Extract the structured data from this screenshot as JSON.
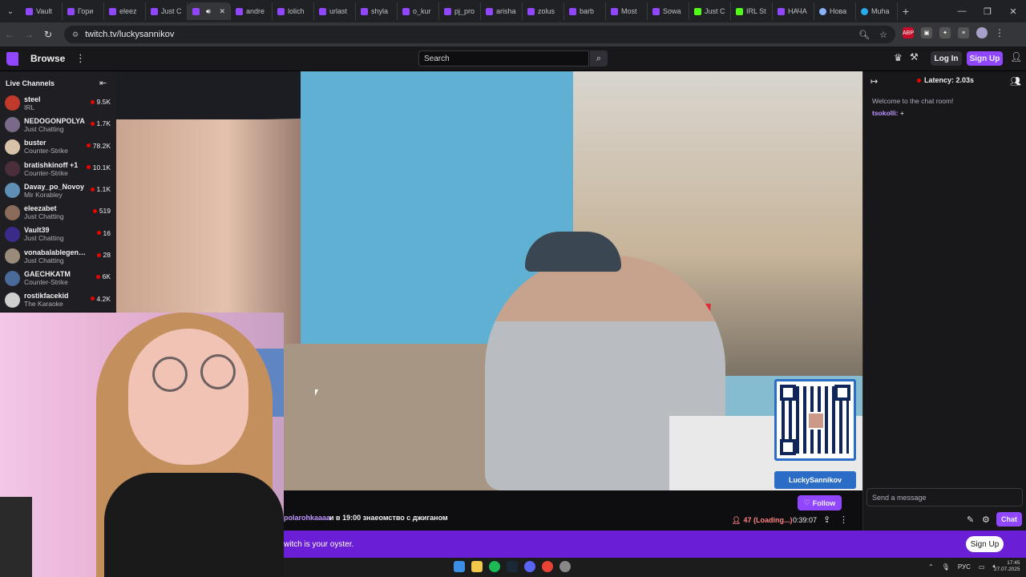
{
  "browser": {
    "tabs": [
      {
        "title": "Vault",
        "icon": "twitch-icon"
      },
      {
        "title": "Гори",
        "icon": "twitch-icon"
      },
      {
        "title": "eleez",
        "icon": "twitch-icon"
      },
      {
        "title": "Just C",
        "icon": "twitch-icon"
      },
      {
        "title": "",
        "icon": "twitch-icon",
        "active": true
      },
      {
        "title": "andre",
        "icon": "twitch-icon"
      },
      {
        "title": "lolich",
        "icon": "twitch-icon"
      },
      {
        "title": "urlast",
        "icon": "twitch-icon"
      },
      {
        "title": "shyla",
        "icon": "twitch-icon"
      },
      {
        "title": "o_kur",
        "icon": "twitch-icon"
      },
      {
        "title": "pj_pro",
        "icon": "twitch-icon"
      },
      {
        "title": "arisha",
        "icon": "twitch-icon"
      },
      {
        "title": "zolus",
        "icon": "twitch-icon"
      },
      {
        "title": "barb",
        "icon": "twitch-icon"
      },
      {
        "title": "Most",
        "icon": "twitch-icon"
      },
      {
        "title": "Sowa",
        "icon": "twitch-icon"
      },
      {
        "title": "Just C",
        "icon": "kick-icon"
      },
      {
        "title": "IRL St",
        "icon": "kick-icon"
      },
      {
        "title": "НАЧА",
        "icon": "twitch-icon"
      },
      {
        "title": "Нова",
        "icon": "globe-icon"
      },
      {
        "title": "Muha",
        "icon": "telegram-icon"
      }
    ],
    "new_tab": "+",
    "url": "twitch.tv/luckysannikov"
  },
  "topnav": {
    "browse": "Browse",
    "search_placeholder": "Search",
    "login": "Log In",
    "signup": "Sign Up"
  },
  "sidebar": {
    "heading": "Live Channels",
    "channels": [
      {
        "name": "steel",
        "game": "IRL",
        "viewers": "9.5K",
        "avatar_color": "#c0392b"
      },
      {
        "name": "NEDOGONPOLYA",
        "game": "Just Chatting",
        "viewers": "1.7K",
        "avatar_color": "#7a6a8a"
      },
      {
        "name": "buster",
        "game": "Counter-Strike",
        "viewers": "78.2K",
        "avatar_color": "#d9c3a8"
      },
      {
        "name": "bratishkinoff +1",
        "game": "Counter-Strike",
        "viewers": "10.1K",
        "avatar_color": "#4a2f3a"
      },
      {
        "name": "Davay_po_Novoy",
        "game": "Mir Korabley",
        "viewers": "1.1K",
        "avatar_color": "#5f8fb5"
      },
      {
        "name": "eleezabet",
        "game": "Just Chatting",
        "viewers": "519",
        "avatar_color": "#8a6a5a"
      },
      {
        "name": "Vault39",
        "game": "Just Chatting",
        "viewers": "16",
        "avatar_color": "#3a2a8a"
      },
      {
        "name": "vonabalablegend...",
        "game": "Just Chatting",
        "viewers": "28",
        "avatar_color": "#9a8a7a"
      },
      {
        "name": "GAECHKATM",
        "game": "Counter-Strike",
        "viewers": "6K",
        "avatar_color": "#4a6a9a"
      },
      {
        "name": "rostikfacekid",
        "game": "The Karaoke",
        "viewers": "4.2K",
        "avatar_color": "#cfcfcf"
      }
    ]
  },
  "stream": {
    "qr_label": "LuckySannikov",
    "follow": "Follow",
    "title_user": "polarohkaaaa",
    "title_text": "и в 19:00 знаeомство с джиганом",
    "viewers": "47 (Loading...)",
    "uptime": "0:39:07"
  },
  "chat": {
    "latency": "Latency: 2.03s",
    "welcome": "Welcome to the chat room!",
    "message_user": "tsokolli:",
    "message_text": " +",
    "input_placeholder": "Send a message",
    "chat_button": "Chat"
  },
  "banner": {
    "text": "witch is your oyster.",
    "signup": "Sign Up"
  },
  "taskbar": {
    "lang": "РУС",
    "time": "17:45",
    "date": "27.07.2025"
  },
  "colors": {
    "twitch_purple": "#9146ff",
    "live_red": "#eb0400",
    "banner_purple": "#6a1fd6"
  }
}
